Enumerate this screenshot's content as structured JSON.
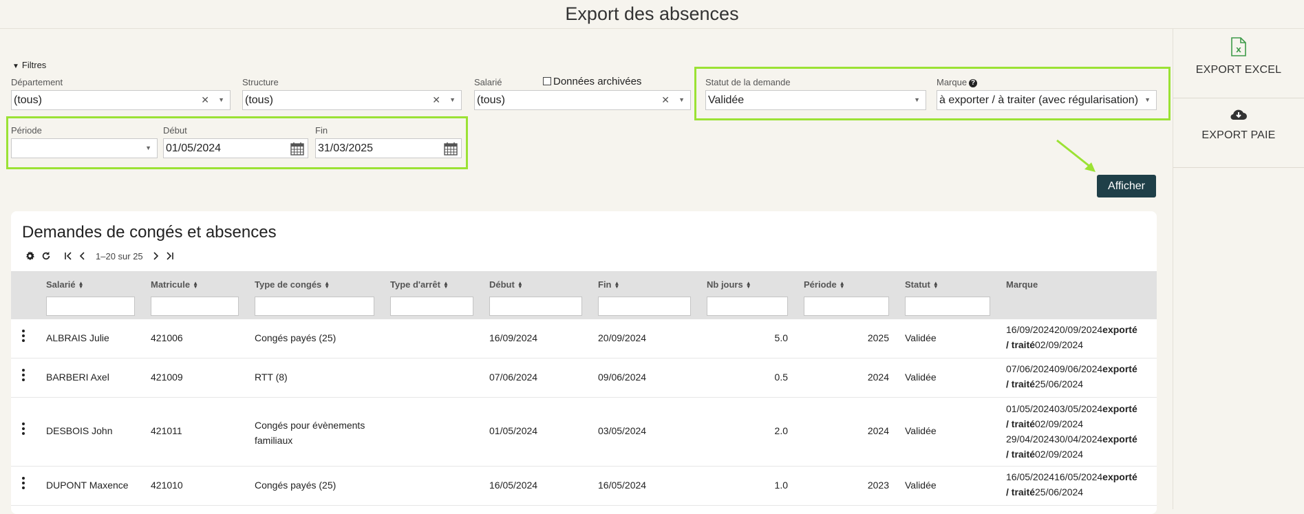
{
  "page": {
    "title": "Export des absences"
  },
  "side": {
    "export_excel": "EXPORT EXCEL",
    "export_paie": "EXPORT PAIE"
  },
  "filters": {
    "toggle": "Filtres",
    "departement": {
      "label": "Département",
      "value": "(tous)"
    },
    "structure": {
      "label": "Structure",
      "value": "(tous)"
    },
    "salarie": {
      "label": "Salarié",
      "value": "(tous)"
    },
    "archived": {
      "label": "Données archivées",
      "checked": false
    },
    "statut": {
      "label": "Statut de la demande",
      "value": "Validée"
    },
    "marque": {
      "label": "Marque",
      "value": "à exporter / à traiter (avec régularisation)"
    },
    "periode": {
      "label": "Période",
      "value": ""
    },
    "debut": {
      "label": "Début",
      "value": "01/05/2024"
    },
    "fin": {
      "label": "Fin",
      "value": "31/03/2025"
    },
    "submit": "Afficher"
  },
  "table": {
    "title": "Demandes de congés et absences",
    "pagination": "1–20 sur 25",
    "columns": [
      "Salarié",
      "Matricule",
      "Type de congés",
      "Type d'arrêt",
      "Début",
      "Fin",
      "Nb jours",
      "Période",
      "Statut",
      "Marque"
    ],
    "rows": [
      {
        "salarie": "ALBRAIS Julie",
        "matricule": "421006",
        "type": "Congés payés (25)",
        "type2": "",
        "debut": "16/09/2024",
        "fin": "20/09/2024",
        "nb": "5.0",
        "periode": "2025",
        "statut": "Validée",
        "marque": [
          {
            "a": "16/09/2024",
            "b": "20/09/2024",
            "c": "exporté",
            "d": "/ traité",
            "e": "02/09/2024"
          }
        ]
      },
      {
        "salarie": "BARBERI Axel",
        "matricule": "421009",
        "type": "RTT (8)",
        "type2": "",
        "debut": "07/06/2024",
        "fin": "09/06/2024",
        "nb": "0.5",
        "periode": "2024",
        "statut": "Validée",
        "marque": [
          {
            "a": "07/06/2024",
            "b": "09/06/2024",
            "c": "exporté",
            "d": "/ traité",
            "e": "25/06/2024"
          }
        ]
      },
      {
        "salarie": "DESBOIS John",
        "matricule": "421011",
        "type": "Congés pour évènements",
        "type_line2": "familiaux",
        "type2": "",
        "debut": "01/05/2024",
        "fin": "03/05/2024",
        "nb": "2.0",
        "periode": "2024",
        "statut": "Validée",
        "marque": [
          {
            "a": "01/05/2024",
            "b": "03/05/2024",
            "c": "exporté",
            "d": "/ traité",
            "e": "02/09/2024"
          },
          {
            "a": "29/04/2024",
            "b": "30/04/2024",
            "c": "exporté",
            "d": "/ traité",
            "e": "02/09/2024"
          }
        ]
      },
      {
        "salarie": "DUPONT Maxence",
        "matricule": "421010",
        "type": "Congés payés (25)",
        "type2": "",
        "debut": "16/05/2024",
        "fin": "16/05/2024",
        "nb": "1.0",
        "periode": "2023",
        "statut": "Validée",
        "marque": [
          {
            "a": "16/05/2024",
            "b": "16/05/2024",
            "c": "exporté",
            "d": "/ traité",
            "e": "25/06/2024"
          }
        ]
      }
    ]
  },
  "icons": {
    "excel": "excel-file-icon",
    "paie": "cloud-download-icon",
    "calendar": "calendar-icon",
    "settings": "gear-icon",
    "refresh": "refresh-icon"
  },
  "colors": {
    "highlight": "#9be234",
    "primary_button": "#1f3f48",
    "background": "#f6f4ee"
  }
}
